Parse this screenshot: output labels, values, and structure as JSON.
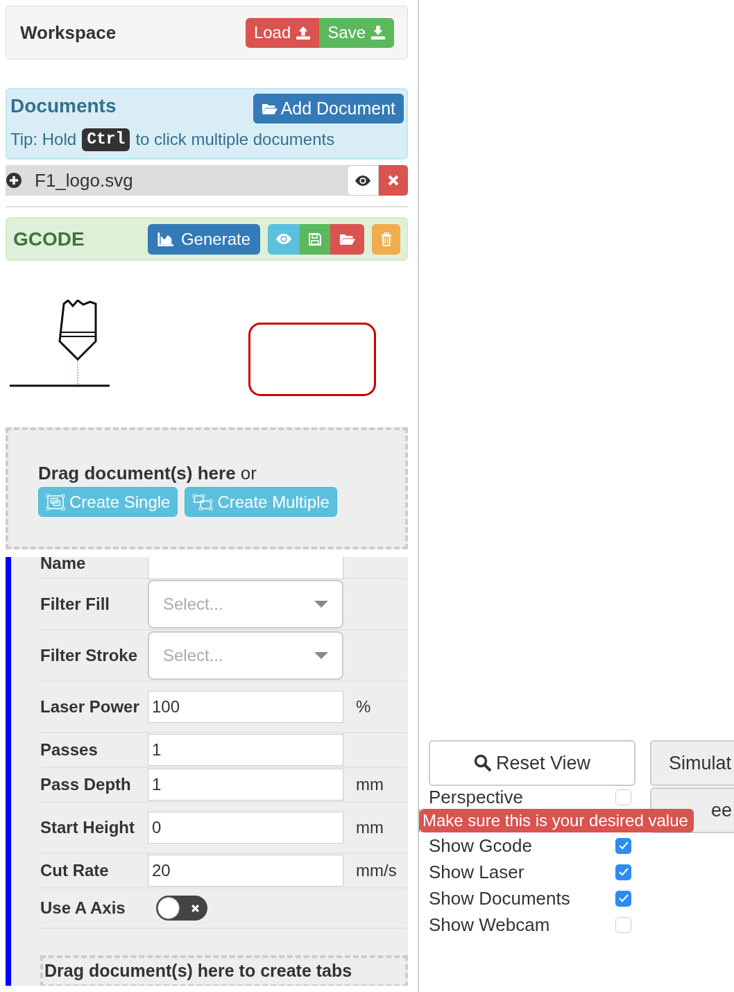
{
  "workspace": {
    "title": "Workspace",
    "buttons": [
      {
        "label": "Load",
        "kind": "load"
      },
      {
        "label": "Save",
        "kind": "save"
      }
    ]
  },
  "documents": {
    "title": "Documents",
    "add_button": "Add Document",
    "tip_before": "Tip: Hold",
    "tip_key": "Ctrl",
    "tip_after": "to click multiple documents",
    "items": [
      {
        "name": "F1_logo.svg"
      }
    ]
  },
  "gcode": {
    "title": "GCODE",
    "generate": "Generate",
    "actions": [
      {
        "kind": "view"
      },
      {
        "kind": "save"
      },
      {
        "kind": "open"
      },
      {
        "kind": "clear"
      }
    ]
  },
  "drop_zone": {
    "text": "**Drag document(s) here** or",
    "buttons": [
      "Create Single",
      "Create Multiple"
    ]
  },
  "operation": {
    "fields": [
      {
        "label": "Name",
        "kind": "text"
      },
      {
        "label": "Filter Fill",
        "kind": "select",
        "placeholder": "Select..."
      },
      {
        "label": "Filter Stroke",
        "kind": "select",
        "placeholder": "Select..."
      },
      {
        "label": "Laser Power",
        "kind": "number",
        "value": "100",
        "unit": "%"
      },
      {
        "label": "Passes",
        "kind": "number",
        "value": "1"
      },
      {
        "label": "Pass Depth",
        "kind": "number",
        "value": "1",
        "unit": "mm"
      },
      {
        "label": "Start Height",
        "kind": "number",
        "value": "0",
        "unit": "mm"
      },
      {
        "label": "Cut Rate",
        "kind": "number",
        "value": "20",
        "unit": "mm/s"
      },
      {
        "label": "Use A Axis",
        "kind": "toggle",
        "on": false
      }
    ],
    "tabs_drop": "Drag document(s) here to create tabs"
  },
  "view": {
    "reset_button": "Reset View",
    "side_buttons": [
      "Simulat",
      "ee"
    ],
    "options": [
      {
        "label": "Perspective",
        "checked": false
      },
      {
        "label": "Show Gcode",
        "checked": true
      },
      {
        "label": "Show Laser",
        "checked": true
      },
      {
        "label": "Show Documents",
        "checked": true
      },
      {
        "label": "Show Webcam",
        "checked": false
      }
    ],
    "tooltip": "Make sure this is your desired value"
  }
}
